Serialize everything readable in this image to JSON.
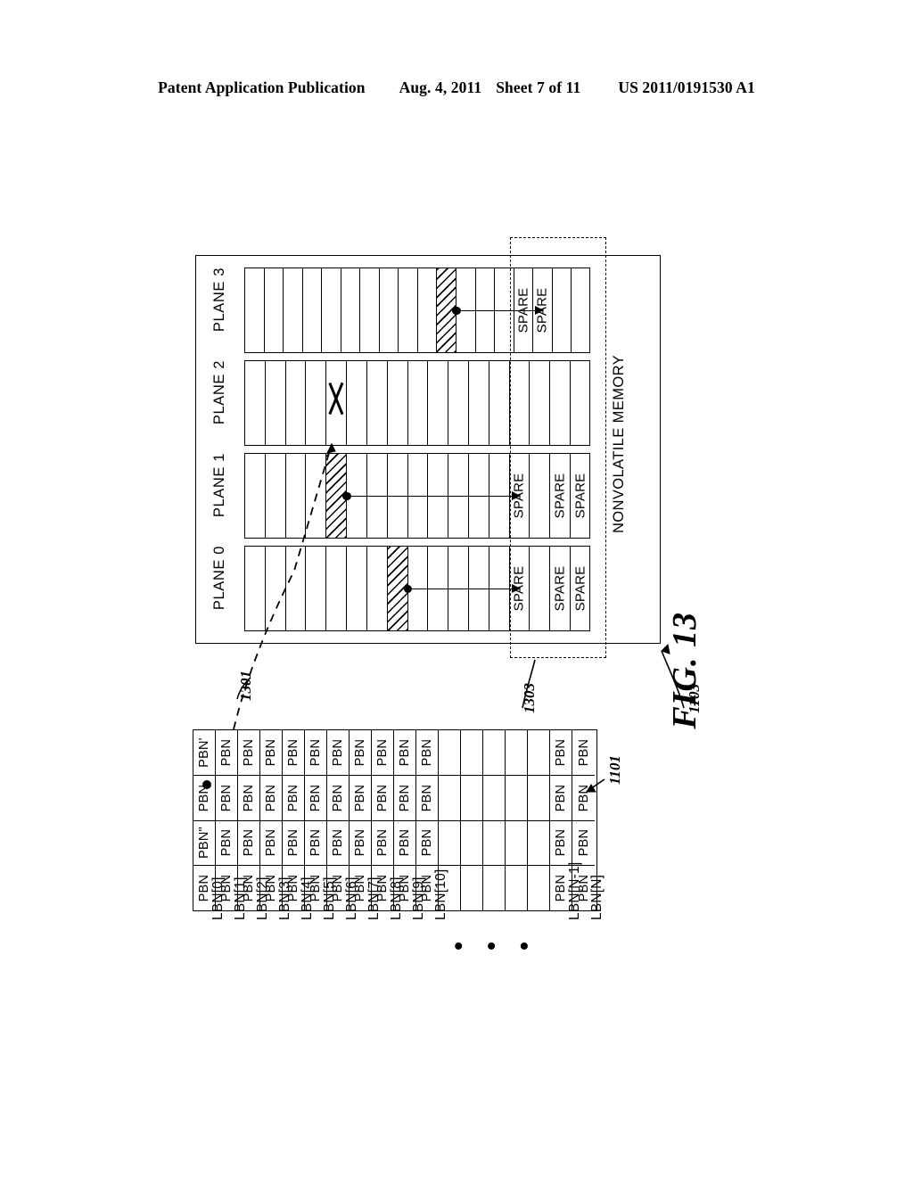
{
  "header": {
    "publication": "Patent Application Publication",
    "date": "Aug. 4, 2011",
    "sheet": "Sheet 7 of 11",
    "docnum": "US 2011/0191530 A1"
  },
  "figure": {
    "title": "FIG. 13",
    "memory_label": "NONVOLATILE MEMORY",
    "ellipsis": "• • •",
    "refs": {
      "table_ref": "1101",
      "memory_ref": "1103",
      "mapping_ref": "1301",
      "spare_region_ref": "1303"
    }
  },
  "planes": [
    {
      "name": "PLANE 3",
      "cells": [
        {
          "label": "",
          "state": "normal"
        },
        {
          "label": "",
          "state": "normal"
        },
        {
          "label": "",
          "state": "normal"
        },
        {
          "label": "",
          "state": "normal"
        },
        {
          "label": "",
          "state": "normal"
        },
        {
          "label": "",
          "state": "normal"
        },
        {
          "label": "",
          "state": "normal"
        },
        {
          "label": "",
          "state": "normal"
        },
        {
          "label": "",
          "state": "normal"
        },
        {
          "label": "",
          "state": "normal"
        },
        {
          "label": "",
          "state": "hatched"
        },
        {
          "label": "",
          "state": "normal"
        },
        {
          "label": "",
          "state": "normal"
        },
        {
          "label": "",
          "state": "normal"
        },
        {
          "label": "SPARE",
          "state": "spare"
        },
        {
          "label": "SPARE",
          "state": "spare"
        },
        {
          "label": "",
          "state": "normal"
        },
        {
          "label": "",
          "state": "normal"
        }
      ],
      "pointer": {
        "from_cell": 10,
        "to_cell": 15
      }
    },
    {
      "name": "PLANE 2",
      "cells": [
        {
          "label": "",
          "state": "normal"
        },
        {
          "label": "",
          "state": "normal"
        },
        {
          "label": "",
          "state": "normal"
        },
        {
          "label": "",
          "state": "normal"
        },
        {
          "label": "",
          "state": "failed"
        },
        {
          "label": "",
          "state": "normal"
        },
        {
          "label": "",
          "state": "normal"
        },
        {
          "label": "",
          "state": "normal"
        },
        {
          "label": "",
          "state": "normal"
        },
        {
          "label": "",
          "state": "normal"
        },
        {
          "label": "",
          "state": "normal"
        },
        {
          "label": "",
          "state": "normal"
        },
        {
          "label": "",
          "state": "normal"
        },
        {
          "label": "",
          "state": "normal"
        },
        {
          "label": "",
          "state": "normal"
        },
        {
          "label": "",
          "state": "normal"
        },
        {
          "label": "",
          "state": "normal"
        }
      ],
      "pointer": null
    },
    {
      "name": "PLANE 1",
      "cells": [
        {
          "label": "",
          "state": "normal"
        },
        {
          "label": "",
          "state": "normal"
        },
        {
          "label": "",
          "state": "normal"
        },
        {
          "label": "",
          "state": "normal"
        },
        {
          "label": "",
          "state": "hatched"
        },
        {
          "label": "",
          "state": "normal"
        },
        {
          "label": "",
          "state": "normal"
        },
        {
          "label": "",
          "state": "normal"
        },
        {
          "label": "",
          "state": "normal"
        },
        {
          "label": "",
          "state": "normal"
        },
        {
          "label": "",
          "state": "normal"
        },
        {
          "label": "",
          "state": "normal"
        },
        {
          "label": "",
          "state": "normal"
        },
        {
          "label": "SPARE",
          "state": "spare"
        },
        {
          "label": "",
          "state": "normal"
        },
        {
          "label": "SPARE",
          "state": "spare"
        },
        {
          "label": "SPARE",
          "state": "spare"
        }
      ],
      "pointer": {
        "from_cell": 4,
        "to_cell": 13
      }
    },
    {
      "name": "PLANE 0",
      "cells": [
        {
          "label": "",
          "state": "normal"
        },
        {
          "label": "",
          "state": "normal"
        },
        {
          "label": "",
          "state": "normal"
        },
        {
          "label": "",
          "state": "normal"
        },
        {
          "label": "",
          "state": "normal"
        },
        {
          "label": "",
          "state": "normal"
        },
        {
          "label": "",
          "state": "normal"
        },
        {
          "label": "",
          "state": "hatched"
        },
        {
          "label": "",
          "state": "normal"
        },
        {
          "label": "",
          "state": "normal"
        },
        {
          "label": "",
          "state": "normal"
        },
        {
          "label": "",
          "state": "normal"
        },
        {
          "label": "",
          "state": "normal"
        },
        {
          "label": "SPARE",
          "state": "spare"
        },
        {
          "label": "",
          "state": "normal"
        },
        {
          "label": "SPARE",
          "state": "spare"
        },
        {
          "label": "SPARE",
          "state": "spare"
        }
      ],
      "pointer": {
        "from_cell": 7,
        "to_cell": 13
      }
    }
  ],
  "mapping_table": {
    "column_count": 4,
    "rows": [
      {
        "name": "LBN[0]",
        "values": [
          "PBN'",
          "PBN",
          "PBN\"",
          "PBN"
        ]
      },
      {
        "name": "LBN[1]",
        "values": [
          "PBN",
          "PBN",
          "PBN",
          "PBN"
        ]
      },
      {
        "name": "LBN[2]",
        "values": [
          "PBN",
          "PBN",
          "PBN",
          "PBN"
        ]
      },
      {
        "name": "LBN[3]",
        "values": [
          "PBN",
          "PBN",
          "PBN",
          "PBN"
        ]
      },
      {
        "name": "LBN[4]",
        "values": [
          "PBN",
          "PBN",
          "PBN",
          "PBN"
        ]
      },
      {
        "name": "LBN[5]",
        "values": [
          "PBN",
          "PBN",
          "PBN",
          "PBN"
        ]
      },
      {
        "name": "LBN[6]",
        "values": [
          "PBN",
          "PBN",
          "PBN",
          "PBN"
        ]
      },
      {
        "name": "LBN[7]",
        "values": [
          "PBN",
          "PBN",
          "PBN",
          "PBN"
        ]
      },
      {
        "name": "LBN[8]",
        "values": [
          "PBN",
          "PBN",
          "PBN",
          "PBN"
        ]
      },
      {
        "name": "LBN[9]",
        "values": [
          "PBN",
          "PBN",
          "PBN",
          "PBN"
        ]
      },
      {
        "name": "LBN[10]",
        "values": [
          "PBN",
          "PBN",
          "PBN",
          "PBN"
        ]
      },
      {
        "name": "",
        "values": [
          "",
          "",
          "",
          ""
        ]
      },
      {
        "name": "",
        "values": [
          "",
          "",
          "",
          ""
        ]
      },
      {
        "name": "",
        "values": [
          "",
          "",
          "",
          ""
        ]
      },
      {
        "name": "",
        "values": [
          "",
          "",
          "",
          ""
        ]
      },
      {
        "name": "",
        "values": [
          "",
          "",
          "",
          ""
        ]
      },
      {
        "name": "LBN[N-1]",
        "values": [
          "PBN",
          "PBN",
          "PBN",
          "PBN"
        ]
      },
      {
        "name": "LBN[N]",
        "values": [
          "PBN",
          "PBN",
          "PBN",
          "PBN"
        ]
      }
    ]
  }
}
